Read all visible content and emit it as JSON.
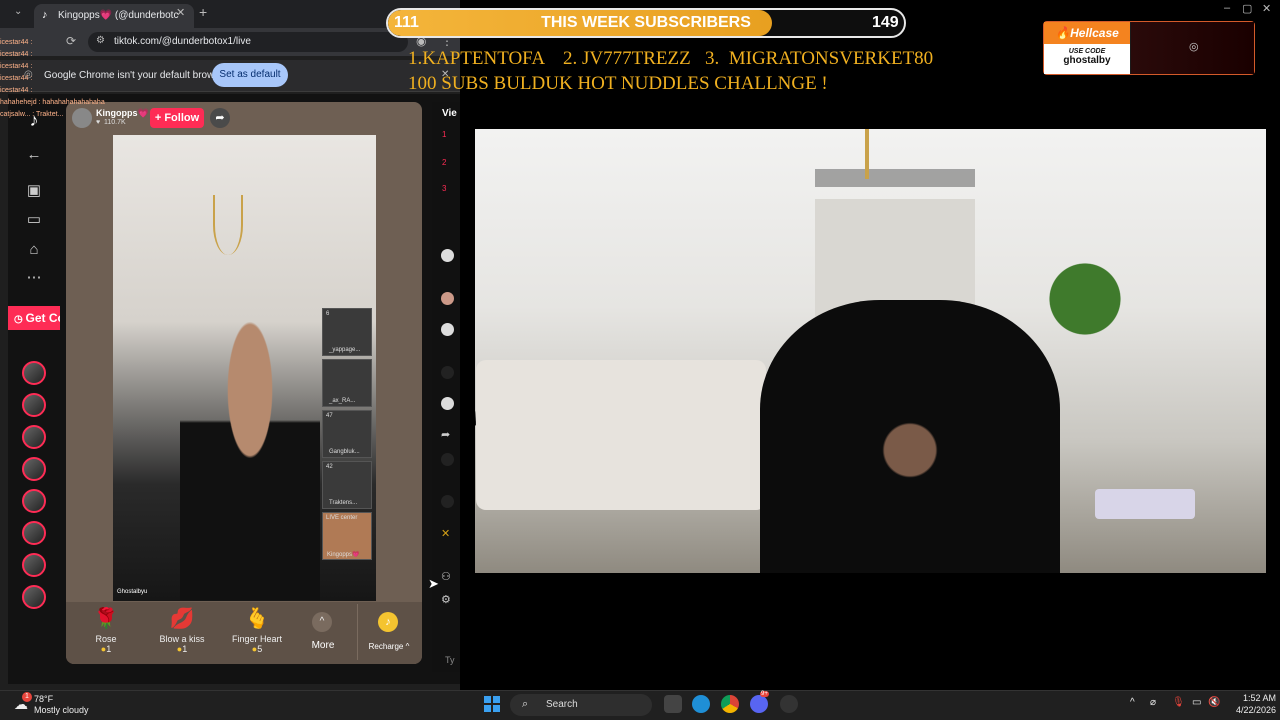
{
  "browser": {
    "tab_title": "Kingopps💗 (@dunderbotc",
    "url": "tiktok.com/@dunderbotox1/live",
    "infobar_text": "Google Chrome isn't your default browser",
    "set_default_label": "Set as default"
  },
  "tiktok": {
    "host_name": "Kingopps💗",
    "host_likes": "110.7K",
    "follow_label": "+ Follow",
    "get_coins_label": "Get Coi",
    "video_username": "Ghostalbyu",
    "viewers_label": "Vie",
    "guests": [
      {
        "count": "6",
        "name": "_yappage..."
      },
      {
        "count": "",
        "name": "_ax_RA..."
      },
      {
        "count": "47",
        "name": "Gangbluk..."
      },
      {
        "count": "42",
        "name": "Traktens..."
      },
      {
        "count": "LIVE center",
        "name": "Kingopps💗"
      }
    ],
    "gifts": [
      {
        "icon": "🌹",
        "name": "Rose",
        "price": "1"
      },
      {
        "icon": "💋",
        "name": "Blow a kiss",
        "price": "1"
      },
      {
        "icon": "🫰",
        "name": "Finger Heart",
        "price": "5"
      }
    ],
    "more_label": "More",
    "recharge_label": "Recharge ^",
    "chat_placeholder": "Ty",
    "rank_numbers": [
      "1",
      "2",
      "3"
    ]
  },
  "chat_overlay": [
    "icestar44 :",
    "icestar44 :",
    "icestar44 :",
    "icestar44 :",
    "icestar44 :",
    "hahahehejd : hahahahahahahaha",
    "catjsalw... : Traktet..."
  ],
  "overlay": {
    "sub_current": "111",
    "sub_title": "THIS WEEK SUBSCRIBERS",
    "sub_goal": "149",
    "sub_progress_fraction": 0.745,
    "ranking_line": "1.KAPTENTOFA    2. JV777TREZZ   3.  MIGRATONSVERKET80",
    "challenge_line": "100 SUBS BULDUK HOT NUDDLES CHALLNGE !",
    "sponsor_logo": "Hellcase",
    "sponsor_use_code": "USE CODE",
    "sponsor_code": "ghostalby"
  },
  "taskbar": {
    "temperature": "78°F",
    "weather_text": "Mostly cloudy",
    "search_label": "Search",
    "time": "1:52 AM",
    "date": "4/22/2026",
    "notification_badge": "1",
    "discord_badge": "9+"
  },
  "colors": {
    "tiktok_red": "#fe2c55",
    "sub_bar_gold": "#f4b53b",
    "ranking_text": "#f0b020",
    "hellcase_orange": "#f4831f"
  }
}
